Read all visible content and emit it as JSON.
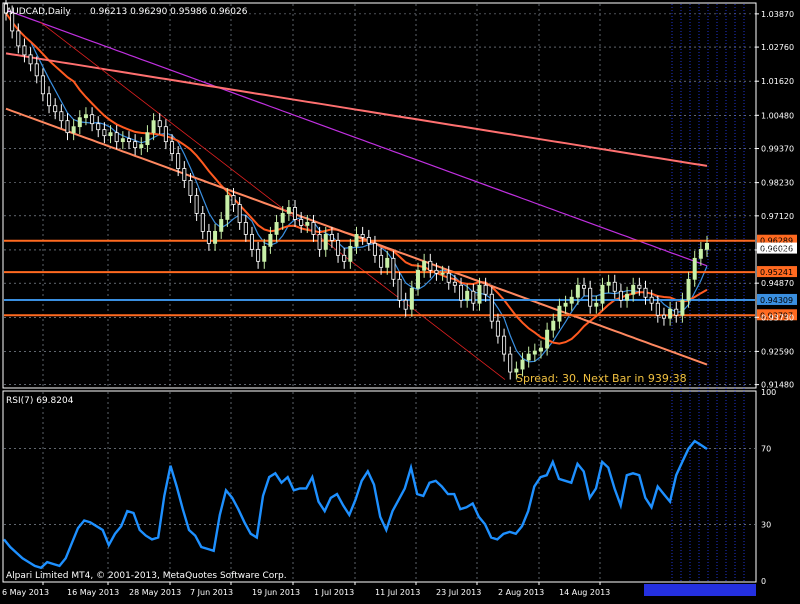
{
  "header": {
    "symbol": "AUDCAD,Daily",
    "ohlc": "0.96213 0.96290 0.95986 0.96026",
    "indicator_title": "RSI(7) 69.8204",
    "footer_copyright": "Alpari Limited MT4, © 2001-2013, MetaQuotes Software Corp.",
    "spread_text": "Spread: 30. Next Bar in 939:38"
  },
  "colors": {
    "background": "#000000",
    "grid": "#9aa3b0",
    "axis_text": "#ffffff",
    "bull_candle": "#c8f0a8",
    "bear_candle": "#ffffff",
    "ma_fast": "#3a8fe0",
    "ma_mid": "#ff5a20",
    "ma_slow_purple": "#c030e0",
    "ma_slow_pink": "#ff7070",
    "ma_long_orange": "#ff8860",
    "rsi_line": "#1e90ff",
    "hline_orange": "#ff6a20",
    "hline_blue": "#3a8fe0",
    "spread_text": "#f0c040"
  },
  "chart_data": [
    {
      "type": "candlestick",
      "title": "AUDCAD,Daily",
      "ylim": [
        0.914,
        1.042
      ],
      "yticks": [
        "1.03870",
        "1.02760",
        "1.01620",
        "1.00480",
        "0.99370",
        "0.98230",
        "0.97120",
        "0.95980",
        "0.94870",
        "0.93730",
        "0.92590",
        "0.91480"
      ],
      "current_price": "0.96026",
      "price_levels": [
        {
          "label": "0.96289",
          "value": 0.96289,
          "color": "orange"
        },
        {
          "label": "0.95241",
          "value": 0.95241,
          "color": "orange"
        },
        {
          "label": "0.94309",
          "value": 0.94309,
          "color": "blue"
        },
        {
          "label": "0.93797",
          "value": 0.93797,
          "color": "orange"
        }
      ],
      "x_labels": [
        "6 May 2013",
        "16 May 2013",
        "28 May 2013",
        "7 Jun 2013",
        "19 Jun 2013",
        "1 Jul 2013",
        "11 Jul 2013",
        "23 Jul 2013",
        "2 Aug 2013",
        "14 Aug 2013"
      ],
      "closes": [
        1.039,
        1.033,
        1.028,
        1.025,
        1.022,
        1.018,
        1.012,
        1.008,
        1.006,
        1.003,
        0.999,
        1.001,
        1.004,
        1.005,
        1.002,
        1.0,
        0.998,
        0.999,
        0.996,
        0.997,
        0.996,
        0.994,
        0.995,
        0.999,
        1.003,
        1.001,
        0.996,
        0.992,
        0.987,
        0.983,
        0.978,
        0.972,
        0.966,
        0.962,
        0.966,
        0.97,
        0.978,
        0.975,
        0.969,
        0.965,
        0.96,
        0.956,
        0.961,
        0.965,
        0.969,
        0.972,
        0.974,
        0.97,
        0.968,
        0.969,
        0.965,
        0.96,
        0.965,
        0.963,
        0.958,
        0.956,
        0.961,
        0.965,
        0.964,
        0.962,
        0.958,
        0.954,
        0.957,
        0.95,
        0.943,
        0.94,
        0.947,
        0.953,
        0.956,
        0.953,
        0.952,
        0.952,
        0.949,
        0.948,
        0.943,
        0.946,
        0.942,
        0.948,
        0.945,
        0.936,
        0.931,
        0.925,
        0.919,
        0.92,
        0.923,
        0.925,
        0.926,
        0.927,
        0.933,
        0.936,
        0.941,
        0.942,
        0.944,
        0.948,
        0.947,
        0.941,
        0.942,
        0.948,
        0.949,
        0.946,
        0.943,
        0.945,
        0.948,
        0.947,
        0.944,
        0.942,
        0.938,
        0.937,
        0.94,
        0.938,
        0.943,
        0.95,
        0.957,
        0.96,
        0.962
      ]
    },
    {
      "type": "line",
      "title": "RSI(7) 69.8204",
      "ylim": [
        0,
        100
      ],
      "yticks": [
        "100",
        "70",
        "30",
        "0"
      ],
      "values": [
        22,
        18,
        15,
        12,
        10,
        8,
        7,
        10,
        9,
        8,
        12,
        20,
        28,
        32,
        31,
        29,
        27,
        19,
        25,
        29,
        37,
        36,
        27,
        24,
        22,
        23,
        45,
        61,
        50,
        38,
        27,
        24,
        18,
        17,
        16,
        35,
        48,
        44,
        38,
        31,
        25,
        23,
        45,
        55,
        57,
        52,
        55,
        48,
        49,
        49,
        55,
        42,
        37,
        44,
        46,
        40,
        35,
        43,
        53,
        58,
        51,
        34,
        27,
        37,
        43,
        49,
        60,
        46,
        45,
        52,
        53,
        50,
        46,
        46,
        38,
        39,
        41,
        34,
        30,
        23,
        22,
        25,
        26,
        25,
        29,
        37,
        50,
        55,
        56,
        63,
        54,
        53,
        52,
        62,
        58,
        44,
        49,
        63,
        60,
        49,
        40,
        56,
        57,
        56,
        44,
        39,
        50,
        46,
        42,
        56,
        63,
        70,
        74,
        72,
        69.82
      ]
    }
  ]
}
